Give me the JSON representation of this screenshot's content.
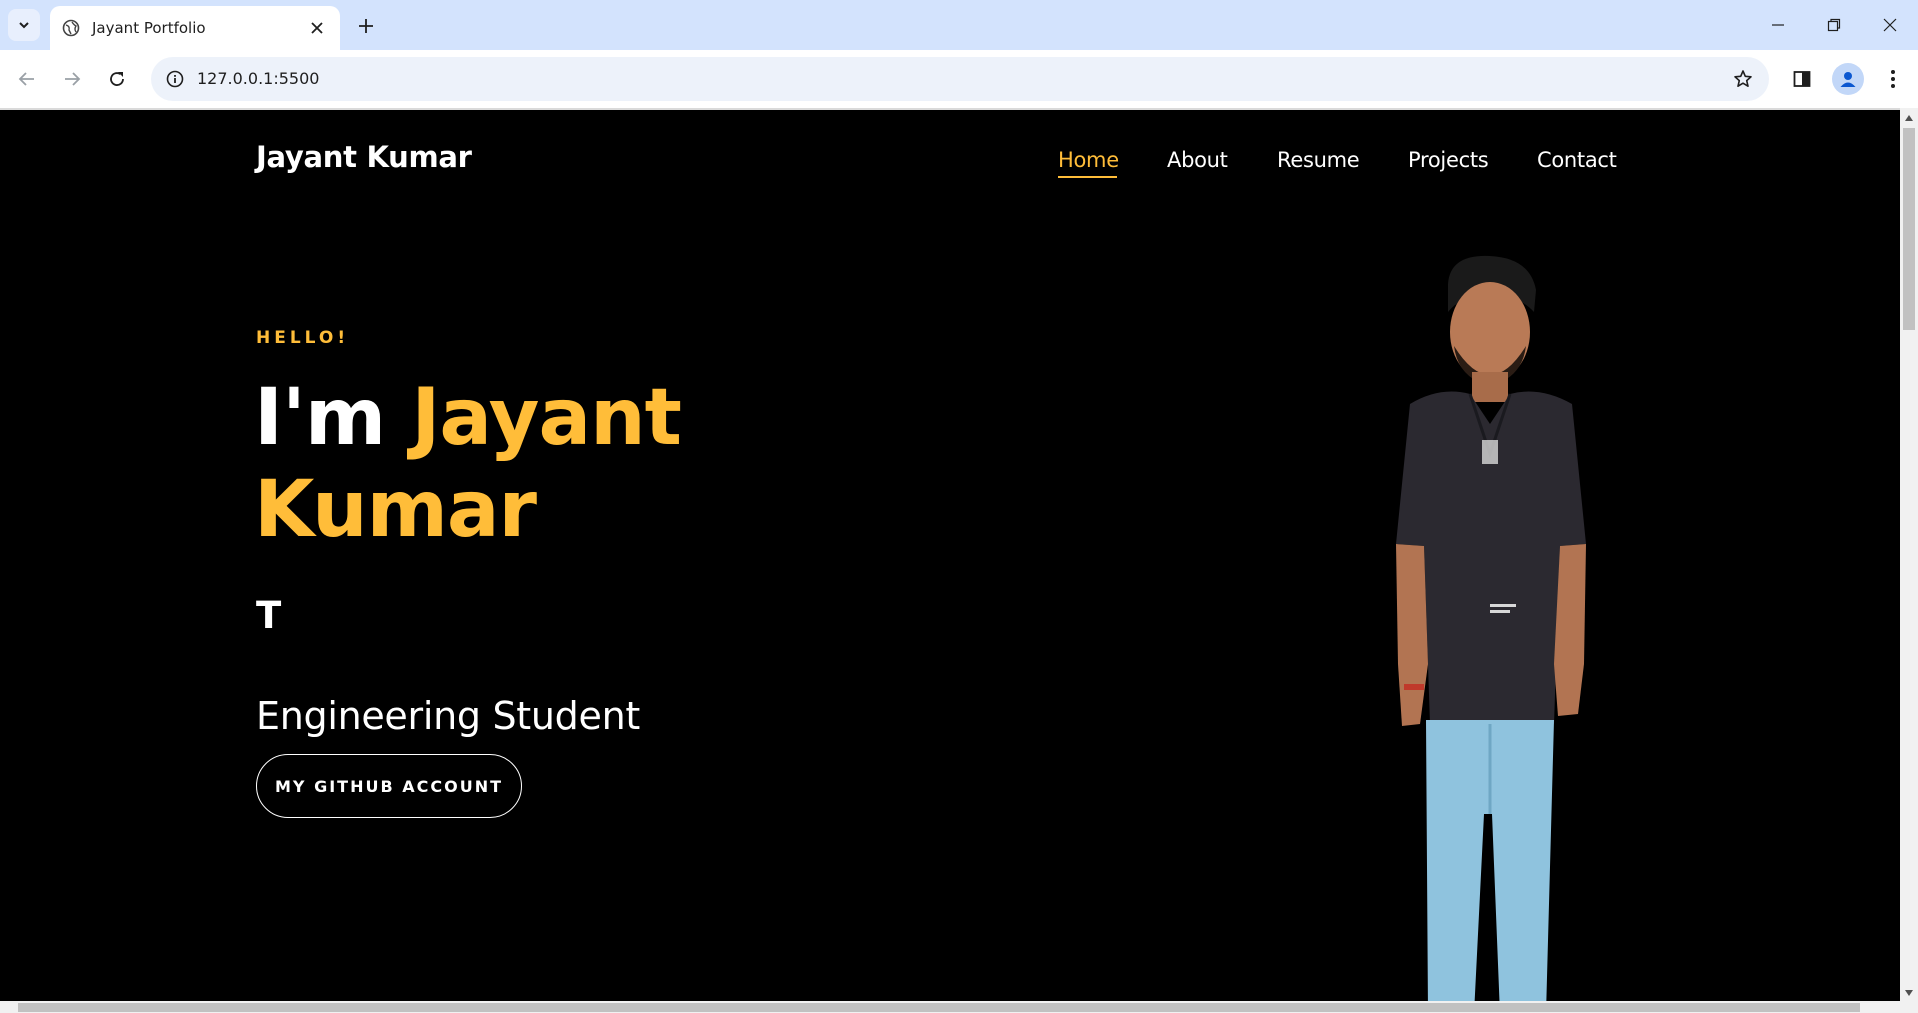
{
  "browser": {
    "tab_title": "Jayant Portfolio",
    "url": "127.0.0.1:5500"
  },
  "site": {
    "brand": "Jayant Kumar",
    "nav": [
      {
        "label": "Home",
        "active": true
      },
      {
        "label": "About",
        "active": false
      },
      {
        "label": "Resume",
        "active": false
      },
      {
        "label": "Projects",
        "active": false
      },
      {
        "label": "Contact",
        "active": false
      }
    ],
    "hero": {
      "greeting": "HELLO!",
      "intro": "I'm",
      "name_line1": "Jayant",
      "name_line2": "Kumar",
      "typed_text": "T",
      "subtitle": "Engineering Student",
      "cta_label": "MY GITHUB ACCOUNT"
    }
  },
  "colors": {
    "accent": "#ffbd39",
    "background": "#000000",
    "text": "#ffffff",
    "chrome_tabstrip": "#d3e3fd"
  },
  "icons": {
    "tab_search": "chevron-down-icon",
    "favicon": "globe-icon",
    "tab_close": "close-icon",
    "new_tab": "plus-icon",
    "back": "arrow-left-icon",
    "forward": "arrow-right-icon",
    "reload": "reload-icon",
    "site_info": "info-icon",
    "bookmark": "star-icon",
    "side_panel": "side-panel-icon",
    "profile": "profile-icon",
    "menu": "kebab-menu-icon"
  }
}
